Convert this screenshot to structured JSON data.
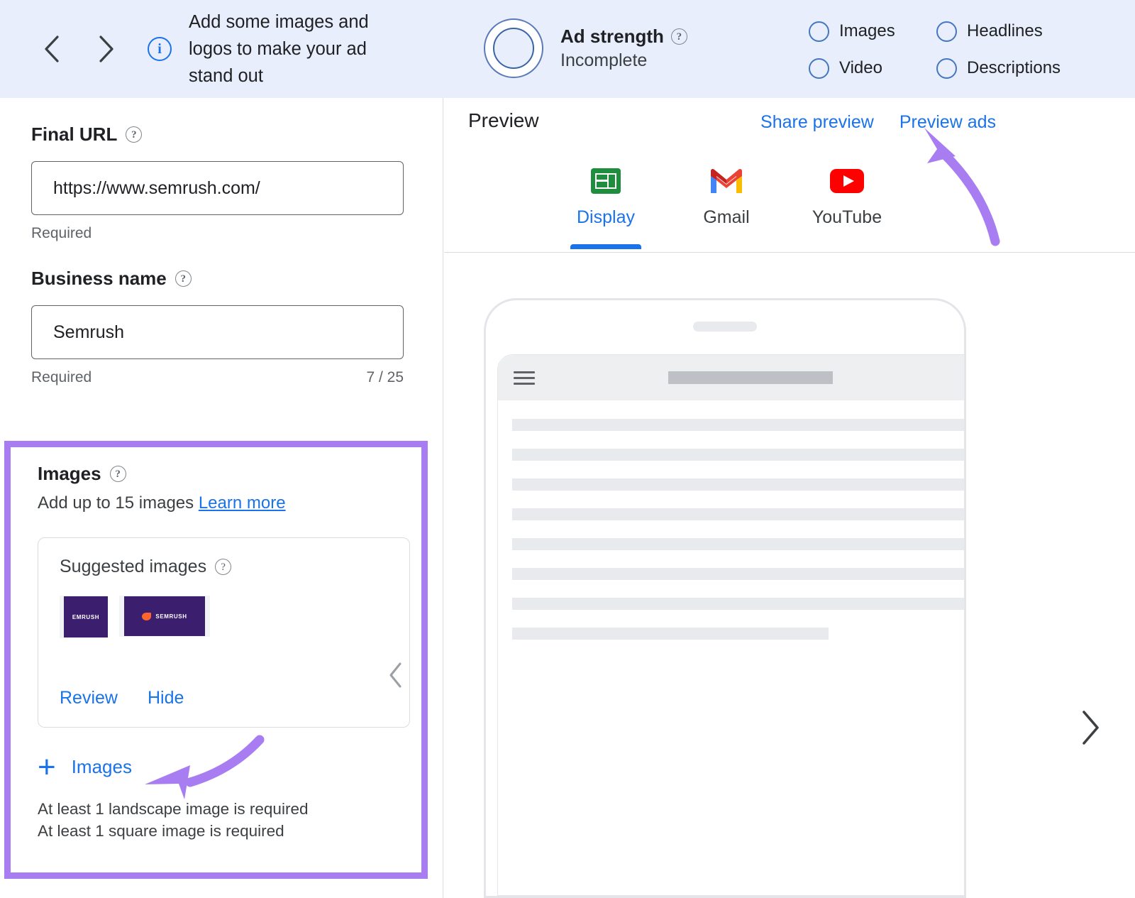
{
  "topbar": {
    "prev_icon": "chevron-left-icon",
    "next_icon": "chevron-right-icon",
    "info_icon": "info-icon",
    "info_glyph": "i",
    "banner_text": "Add some images and logos to make your ad stand out",
    "ad_strength": {
      "title": "Ad strength",
      "status": "Incomplete",
      "help_icon": "help-icon",
      "ring_color": "#3B63A8"
    },
    "checklist": [
      {
        "label": "Images",
        "checked": false
      },
      {
        "label": "Headlines",
        "checked": false
      },
      {
        "label": "Video",
        "checked": false
      },
      {
        "label": "Descriptions",
        "checked": false
      }
    ]
  },
  "left": {
    "final_url": {
      "label": "Final URL",
      "help_icon": "help-icon",
      "value": "https://www.semrush.com/",
      "helper": "Required"
    },
    "business_name": {
      "label": "Business name",
      "help_icon": "help-icon",
      "value": "Semrush",
      "helper": "Required",
      "counter": "7 / 25"
    },
    "images": {
      "label": "Images",
      "help_icon": "help-icon",
      "subtitle": "Add up to 15 images",
      "learn_more": "Learn more",
      "highlight_color": "#A87DF2",
      "suggested": {
        "title": "Suggested images",
        "help_icon": "help-icon",
        "thumbs": [
          {
            "name": "semrush-wordmark-thumb",
            "text": "EMRUSH"
          },
          {
            "name": "semrush-logo-thumb",
            "text": "SEMRUSH"
          }
        ],
        "review_label": "Review",
        "hide_label": "Hide",
        "collapse_icon": "chevron-left-icon"
      },
      "add_label": "Images",
      "add_icon": "plus-icon",
      "requirements": [
        "At least 1 landscape image is required",
        "At least 1 square image is required"
      ]
    }
  },
  "right": {
    "preview_title": "Preview",
    "share_preview": "Share preview",
    "preview_ads": "Preview ads",
    "tabs": [
      {
        "label": "Display",
        "icon": "display-ad-icon",
        "active": true
      },
      {
        "label": "Gmail",
        "icon": "gmail-icon",
        "active": false
      },
      {
        "label": "YouTube",
        "icon": "youtube-icon",
        "active": false
      }
    ],
    "phone": {
      "menu_icon": "hamburger-menu-icon",
      "search_icon": "search-icon",
      "skeleton_lines": 8
    },
    "next_icon": "chevron-right-icon"
  },
  "annotations": {
    "arrow_color": "#A87DF2",
    "arrow_to_preview_ads": "arrow-annotation-preview-ads",
    "arrow_to_add_images": "arrow-annotation-add-images"
  }
}
